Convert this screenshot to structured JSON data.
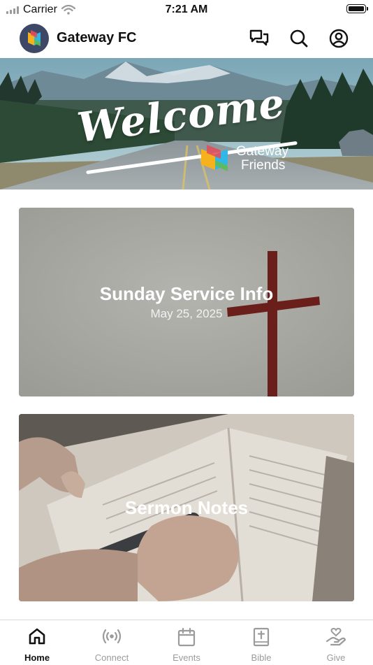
{
  "status_bar": {
    "carrier": "Carrier",
    "time": "7:21 AM"
  },
  "header": {
    "title": "Gateway FC"
  },
  "hero": {
    "headline": "Welcome",
    "brand_line1": "Gateway",
    "brand_line2": "Friends"
  },
  "cards": [
    {
      "title": "Sunday Service Info",
      "subtitle": "May 25, 2025"
    },
    {
      "title": "Sermon Notes"
    }
  ],
  "tabs": [
    {
      "label": "Home",
      "icon": "home-icon",
      "active": true
    },
    {
      "label": "Connect",
      "icon": "broadcast-icon",
      "active": false
    },
    {
      "label": "Events",
      "icon": "calendar-icon",
      "active": false
    },
    {
      "label": "Bible",
      "icon": "bible-icon",
      "active": false
    },
    {
      "label": "Give",
      "icon": "give-icon",
      "active": false
    }
  ],
  "colors": {
    "active_tab": "#111111",
    "inactive_tab": "#9b9b9b",
    "logo_bg": "#3d4866"
  }
}
